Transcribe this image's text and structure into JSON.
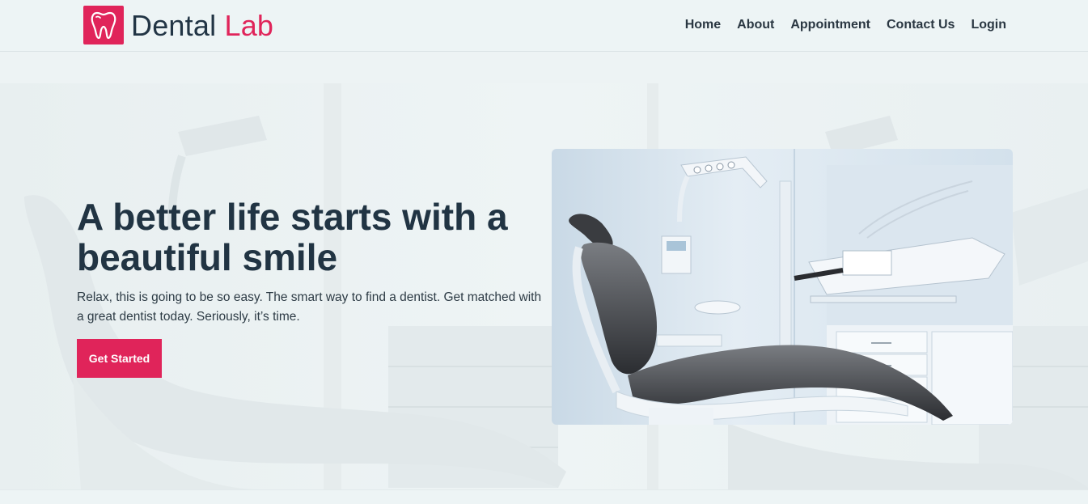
{
  "brand": {
    "name_part1": "Dental",
    "name_part2": "Lab",
    "logo_icon": "tooth-icon",
    "accent_color": "#e0245a"
  },
  "nav": {
    "items": [
      {
        "label": "Home"
      },
      {
        "label": "About"
      },
      {
        "label": "Appointment"
      },
      {
        "label": "Contact Us"
      },
      {
        "label": "Login"
      }
    ]
  },
  "hero": {
    "headline": "A better life starts with a beautiful smile",
    "subtext": "Relax, this is going to be so easy. The smart way to find a dentist. Get matched with a great dentist today. Seriously, it’s time.",
    "cta_label": "Get Started",
    "image_subject": "dental chair in clinic"
  }
}
